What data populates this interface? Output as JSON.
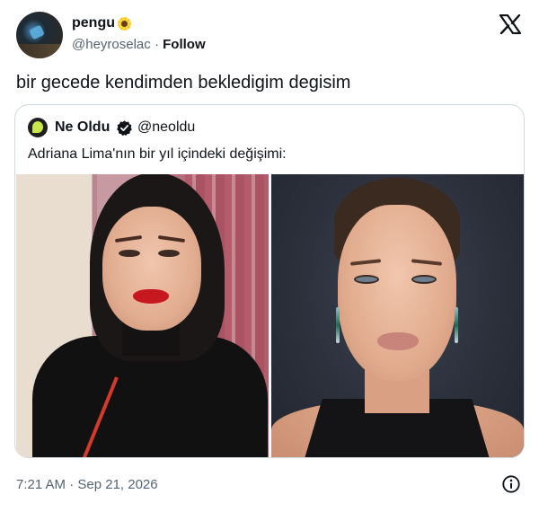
{
  "author": {
    "display_name": "pengu",
    "name_emoji": "sunflower",
    "handle": "@heyroselac",
    "follow_label": "Follow",
    "avatar_icon": "avatar-photo"
  },
  "platform_logo": "x-logo",
  "tweet_text": "bir gecede kendimden bekledigim degisim",
  "quoted": {
    "display_name": "Ne Oldu",
    "verified": true,
    "handle": "@neoldu",
    "text": "Adriana Lima'nın bir yıl içindeki değişimi:",
    "images": [
      {
        "name": "photo-before"
      },
      {
        "name": "photo-after"
      }
    ]
  },
  "footer": {
    "timestamp": "7:21 AM · Sep 21, 2026",
    "info_icon": "info-icon"
  },
  "colors": {
    "text": "#0f1419",
    "secondary": "#536471",
    "border": "#cfd9de",
    "verified_gold": "#e2b719"
  }
}
